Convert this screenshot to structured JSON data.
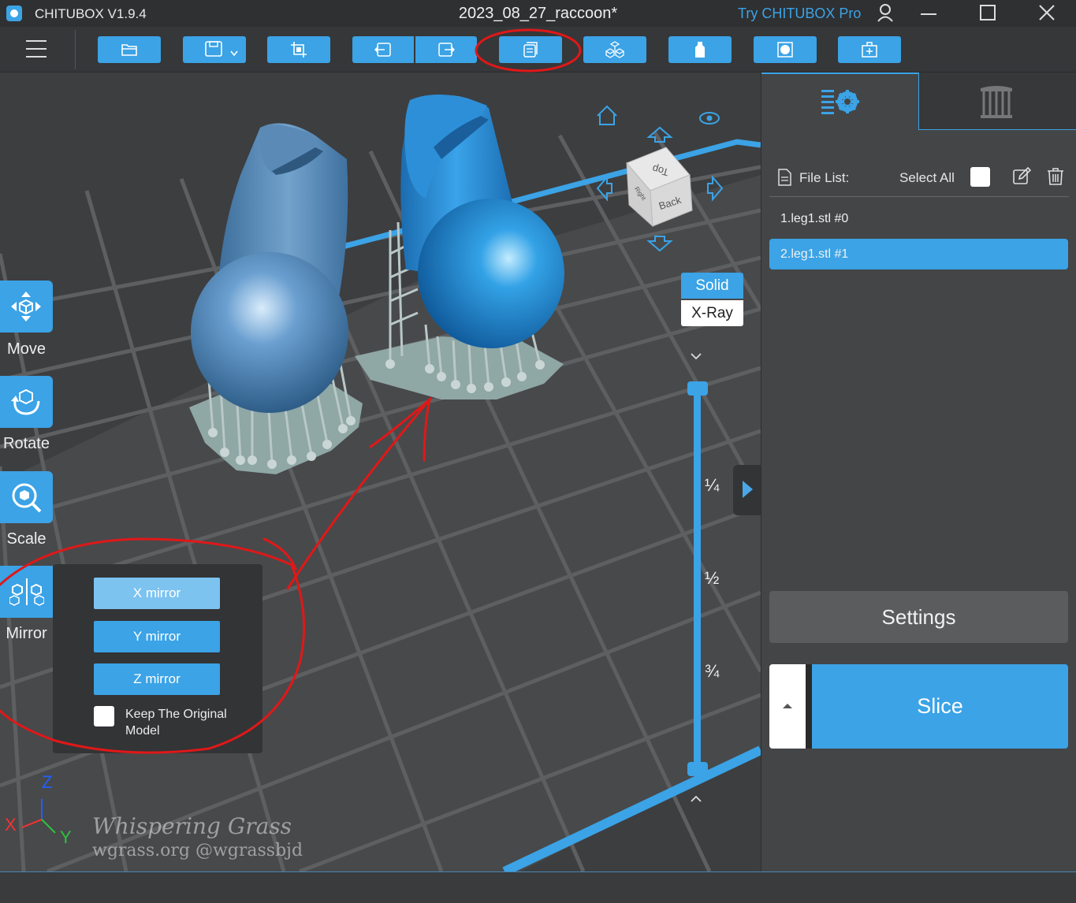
{
  "titlebar": {
    "app_title": "CHITUBOX V1.9.4",
    "document_title": "2023_08_27_raccoon*",
    "pro_link": "Try CHITUBOX Pro"
  },
  "toolbar": {
    "buttons": [
      {
        "icon": "open-folder-icon"
      },
      {
        "icon": "save-icon"
      },
      {
        "icon": "crop-frame-icon"
      },
      {
        "icon": "undo-icon"
      },
      {
        "icon": "redo-icon"
      },
      {
        "icon": "duplicate-icon"
      },
      {
        "icon": "layout-cubes-icon"
      },
      {
        "icon": "hollow-bottle-icon"
      },
      {
        "icon": "dig-hole-icon"
      },
      {
        "icon": "toolbox-icon"
      }
    ]
  },
  "left_tools": {
    "move": "Move",
    "rotate": "Rotate",
    "scale": "Scale",
    "mirror": "Mirror"
  },
  "mirror_panel": {
    "x_mirror": "X mirror",
    "y_mirror": "Y mirror",
    "z_mirror": "Z mirror",
    "keep_original": "Keep The Original Model",
    "keep_original_checked": false
  },
  "viewport": {
    "view_modes": {
      "solid": "Solid",
      "xray": "X-Ray",
      "selected": "Solid"
    },
    "view_cube": {
      "top": "Top",
      "back": "Back",
      "side": "Right"
    },
    "layer_slider": {
      "marks": [
        "¼",
        "½",
        "¾"
      ]
    },
    "axes": {
      "x": "X",
      "y": "Y",
      "z": "Z"
    },
    "watermark": {
      "line1": "Whispering Grass",
      "line2": "wgrass.org @wgrassbjd"
    }
  },
  "right_panel": {
    "file_list_label": "File List:",
    "select_all_label": "Select All",
    "files": [
      "1.leg1.stl #0",
      "2.leg1.stl #1"
    ],
    "selected_file": "2.leg1.stl #1",
    "settings_button": "Settings",
    "slice_button": "Slice"
  },
  "colors": {
    "accent": "#3ba3e6",
    "annotation": "#e01818",
    "model": "#5b9bd5"
  }
}
